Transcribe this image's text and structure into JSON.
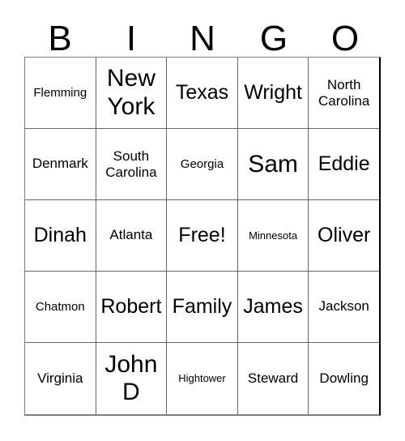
{
  "card": {
    "title": "BINGO",
    "headers": [
      "B",
      "I",
      "N",
      "G",
      "O"
    ],
    "free_space_label": "Free!",
    "colors": {
      "text": "#000000",
      "cell_background": "#ffffff",
      "grid_border": "#000000",
      "inner_border": "#666666",
      "page_background": "#ffffff"
    },
    "grid": {
      "columns": 5,
      "rows": 5,
      "cells": [
        [
          {
            "label": "Flemming",
            "size": "sm",
            "lines": 1
          },
          {
            "label": "New York",
            "size": "xxl",
            "lines": 2
          },
          {
            "label": "Texas",
            "size": "xl",
            "lines": 1
          },
          {
            "label": "Wright",
            "size": "xl",
            "lines": 1
          },
          {
            "label": "North Carolina",
            "size": "md",
            "lines": 2
          }
        ],
        [
          {
            "label": "Denmark",
            "size": "md",
            "lines": 1
          },
          {
            "label": "South Carolina",
            "size": "md",
            "lines": 2
          },
          {
            "label": "Georgia",
            "size": "sm",
            "lines": 1
          },
          {
            "label": "Sam",
            "size": "xxl",
            "lines": 1
          },
          {
            "label": "Eddie",
            "size": "xl",
            "lines": 1
          }
        ],
        [
          {
            "label": "Dinah",
            "size": "xl",
            "lines": 1
          },
          {
            "label": "Atlanta",
            "size": "md",
            "lines": 1
          },
          {
            "label": "Free!",
            "size": "xl",
            "lines": 1
          },
          {
            "label": "Minnesota",
            "size": "xs",
            "lines": 1
          },
          {
            "label": "Oliver",
            "size": "xl",
            "lines": 1
          }
        ],
        [
          {
            "label": "Chatmon",
            "size": "sm",
            "lines": 1
          },
          {
            "label": "Robert",
            "size": "xl",
            "lines": 1
          },
          {
            "label": "Family",
            "size": "xl",
            "lines": 1
          },
          {
            "label": "James",
            "size": "xl",
            "lines": 1
          },
          {
            "label": "Jackson",
            "size": "md",
            "lines": 1
          }
        ],
        [
          {
            "label": "Virginia",
            "size": "md",
            "lines": 1
          },
          {
            "label": "John D",
            "size": "xxl",
            "lines": 2
          },
          {
            "label": "Hightower",
            "size": "xs",
            "lines": 1
          },
          {
            "label": "Steward",
            "size": "md",
            "lines": 1
          },
          {
            "label": "Dowling",
            "size": "md",
            "lines": 1
          }
        ]
      ]
    }
  }
}
